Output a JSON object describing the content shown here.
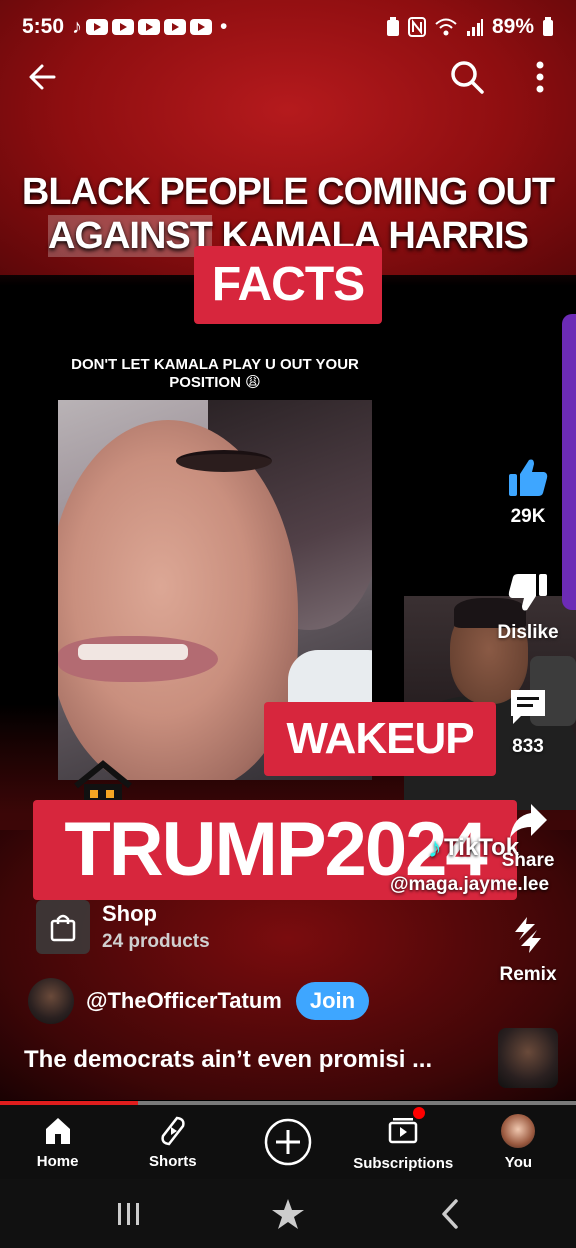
{
  "status_bar": {
    "time": "5:50",
    "battery": "89%"
  },
  "video": {
    "headline_line1": "BLACK PEOPLE COMING OUT",
    "headline_line2_a": "AGAINST",
    "headline_line2_b": " KAMALA HARRIS",
    "tag_facts": "FACTS",
    "caption_small": "DON'T LET KAMALA PLAY U OUT YOUR POSITION 😩",
    "tag_wakeup": "WAKEUP",
    "tag_trump": "TRUMP2024",
    "tiktok_label": "TikTok",
    "tiktok_handle": "@maga.jayme.lee"
  },
  "actions": {
    "like_count": "29K",
    "dislike_label": "Dislike",
    "comments_count": "833",
    "share_label": "Share",
    "remix_label": "Remix"
  },
  "shop": {
    "title": "Shop",
    "subtitle": "24 products"
  },
  "channel": {
    "handle": "@TheOfficerTatum",
    "join_label": "Join"
  },
  "short_title": "The democrats ain’t even promisi ...",
  "progress": {
    "fraction": 0.24
  },
  "bottom_nav": {
    "home": "Home",
    "shorts": "Shorts",
    "subscriptions": "Subscriptions",
    "you": "You"
  },
  "icons": {
    "back": "arrow-left-icon",
    "search": "search-icon",
    "more": "more-vert-icon",
    "like": "thumb-up-icon",
    "dislike": "thumb-down-icon",
    "comments": "comment-icon",
    "share": "share-icon",
    "remix": "remix-icon",
    "shop": "shopping-bag-icon"
  },
  "colors": {
    "tag_red": "#d7263d",
    "join_blue": "#3ea6ff",
    "like_blue": "#3ea6ff",
    "progress_red": "#e01d1d"
  }
}
